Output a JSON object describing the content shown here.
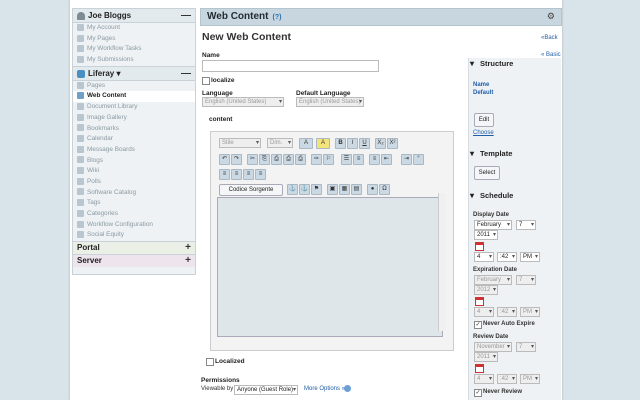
{
  "sidebar": {
    "user": "Joe Bloggs",
    "user_items": [
      "My Account",
      "My Pages",
      "My Workflow Tasks",
      "My Submissions"
    ],
    "site": "Liferay ▾",
    "site_items": [
      "Pages",
      "Web Content",
      "Document Library",
      "Image Gallery",
      "Bookmarks",
      "Calendar",
      "Message Boards",
      "Blogs",
      "Wiki",
      "Polls",
      "Software Catalog",
      "Tags",
      "Categories",
      "Workflow Configuration",
      "Social Equity"
    ],
    "active_item": "Web Content",
    "portal": "Portal",
    "server": "Server",
    "collapse": "—",
    "expand": "+"
  },
  "header": {
    "title": "Web Content",
    "help": "(?)",
    "wrench": "🔧"
  },
  "form": {
    "title": "New Web Content",
    "back": "«Back",
    "name_label": "Name",
    "name_value": "",
    "localize_label": "localize",
    "language_label": "Language",
    "language_value": "English (United States)",
    "default_language_label": "Default Language",
    "default_language_value": "English (United States)",
    "content_label": "content",
    "localized_label": "Localized",
    "permissions_label": "Permissions",
    "viewable_by_label": "Viewable by",
    "viewable_by_value": "Anyone (Guest Role)",
    "more_options": "More Options »"
  },
  "editor": {
    "style_placeholder": "Stile",
    "size_placeholder": "Dim.",
    "source_button": "Codice Sorgente",
    "row1": [
      "A",
      "A",
      "B",
      "I",
      "U",
      "X₂",
      "X²"
    ],
    "row2": [
      "↶",
      "↷",
      "✂",
      "⎘",
      "⎙",
      "⎙",
      "⎙",
      "✑",
      "⚐",
      "☰",
      "≡",
      "≡",
      "⇤",
      "⇥",
      "“"
    ],
    "row3": [
      "≡",
      "≡",
      "≡",
      "≡"
    ],
    "row4": [
      "⚓",
      "⚓",
      "⚑",
      "▣",
      "▦",
      "▤",
      "●",
      "Ω"
    ]
  },
  "right": {
    "basic_link": "« Basic",
    "structure": "Structure",
    "structure_name_label": "Name",
    "structure_name_value": "Default",
    "edit": "Edit",
    "choose": "Choose",
    "template": "Template",
    "select": "Select",
    "schedule": "Schedule",
    "display_date": "Display Date",
    "display_month": "February",
    "display_day": "7",
    "display_year": "2011",
    "display_hour": "4",
    "display_min": ":42",
    "display_ampm": "PM",
    "expiration_date": "Expiration Date",
    "exp_month": "February",
    "exp_day": "7",
    "exp_year": "2012",
    "exp_hour": "4",
    "exp_min": ":42",
    "exp_ampm": "PM",
    "never_expire": "Never Auto Expire",
    "review_date": "Review Date",
    "rev_month": "November",
    "rev_day": "7",
    "rev_year": "2011",
    "rev_hour": "4",
    "rev_min": ":42",
    "rev_ampm": "PM",
    "never_review": "Never Review",
    "check": "✓"
  },
  "colors": {
    "accent": "#1f5ea8",
    "header": "#c8d7df",
    "background": "#d9e4ea"
  }
}
